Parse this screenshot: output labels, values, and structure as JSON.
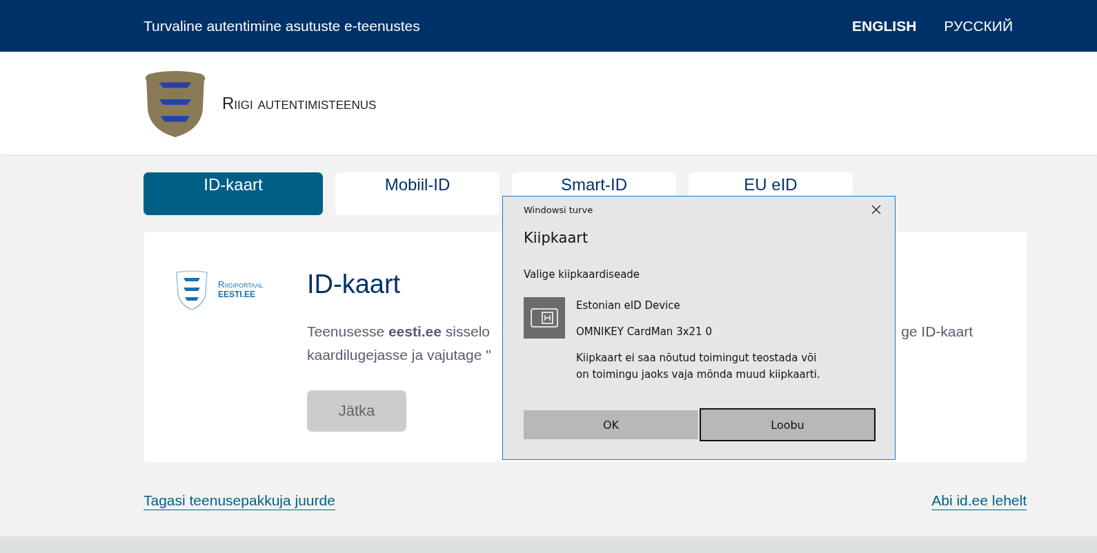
{
  "top_bar": {
    "title": "Turvaline autentimine asutuste e-teenustes",
    "languages": [
      {
        "label": "ENGLISH",
        "selected": false
      },
      {
        "label": "РУССКИЙ",
        "selected": false
      }
    ]
  },
  "brand": {
    "name": "Riigi autentimisteenus"
  },
  "tabs": [
    {
      "label": "ID-kaart",
      "selected": true
    },
    {
      "label": "Mobiil-ID",
      "selected": false
    },
    {
      "label": "Smart-ID",
      "selected": false
    },
    {
      "label": "EU eID",
      "selected": false
    }
  ],
  "panel": {
    "service_logo": {
      "line_1": "Riigiportaal",
      "line_2": "EESTI.EE"
    },
    "heading": "ID-kaart",
    "text_lines": [
      {
        "left": "Teenusesse **eesti.ee** sisselo",
        "right": "ge ID-kaart"
      },
      {
        "left": "kaardilugejasse ja vajutage \""
      }
    ],
    "button": {
      "label": "Jätka",
      "disabled": true
    }
  },
  "links": [
    {
      "label": "Tagasi teenusepakkuja juurde"
    },
    {
      "label": "Abi id.ee lehelt"
    }
  ],
  "dialog": {
    "window_title": "Windowsi turve",
    "title": "Kiipkaart",
    "prompt": "Valige kiipkaardiseade",
    "device": {
      "name": "Estonian eID Device",
      "reader": "OMNIKEY CardMan 3x21 0",
      "message": "Kiipkaart ei saa nõutud toimingut teostada või\non toimingu jaoks vaja mõnda muud kiipkaarti."
    },
    "buttons": [
      {
        "label": "OK",
        "focused": false
      },
      {
        "label": "Loobu",
        "focused": true
      }
    ]
  }
}
